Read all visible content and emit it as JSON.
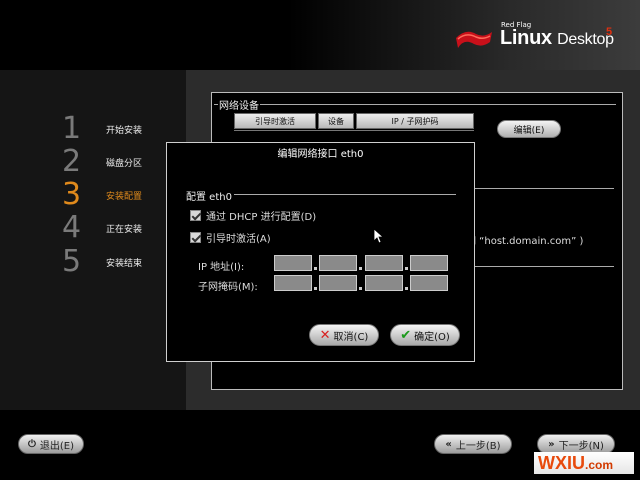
{
  "brand": {
    "small": "Red Flag",
    "linux": "Linux",
    "desktop": "Desktop",
    "version": "5",
    "accent": "#e08a1c"
  },
  "steps": [
    {
      "num": "1",
      "label": "开始安装"
    },
    {
      "num": "2",
      "label": "磁盘分区"
    },
    {
      "num": "3",
      "label": "安装配置",
      "active": true
    },
    {
      "num": "4",
      "label": "正在安装"
    },
    {
      "num": "5",
      "label": "安装结束"
    }
  ],
  "network": {
    "group_title": "网络设备",
    "columns": [
      "引导时激活",
      "设备",
      "IP / 子网护码"
    ],
    "edit_label": "编辑(E)",
    "hint": "例如 “host.domain.com” )"
  },
  "dialog": {
    "title": "编辑网络接口  eth0",
    "config_title": "配置  eth0",
    "dhcp_label": "通过 DHCP 进行配置(D)",
    "activate_label": "引导时激活(A)",
    "ip_label": "IP 地址(I):",
    "mask_label": "子网掩码(M):",
    "cancel_label": "取消(C)",
    "ok_label": "确定(O)"
  },
  "footer": {
    "exit_label": "退出(E)",
    "prev_label": "上一步(B)",
    "next_label": "下一步(N)"
  },
  "watermark": {
    "main": "WXIU",
    "suffix": ".com"
  }
}
